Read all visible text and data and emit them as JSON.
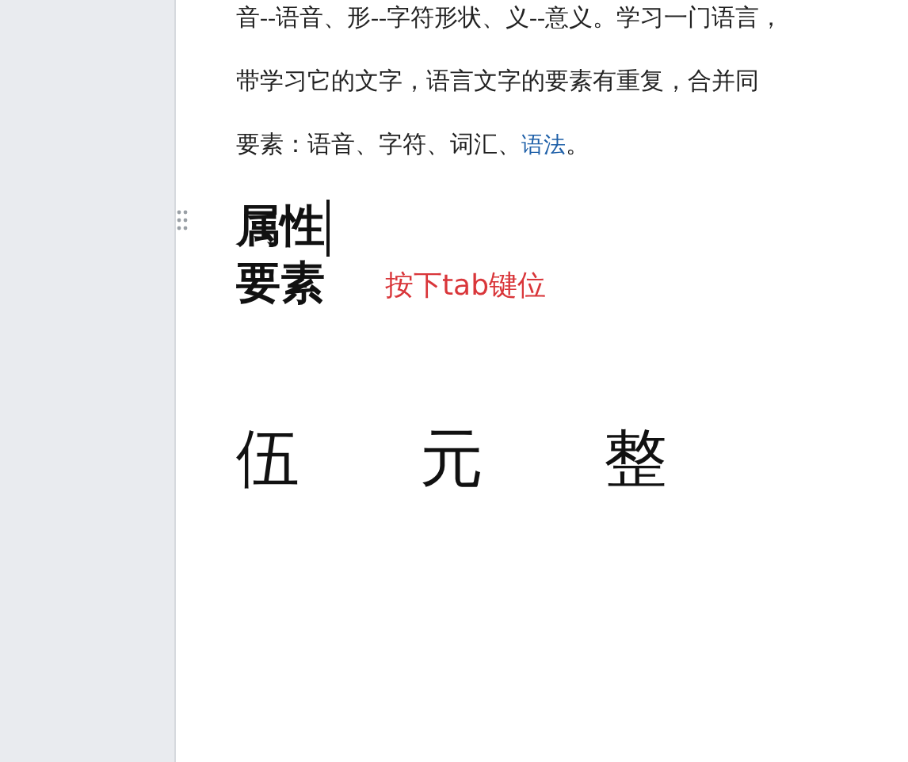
{
  "paragraphs": [
    [
      {
        "kind": "text",
        "text": "音--语音、形--字符形状、义--意义。学习一门语言，"
      }
    ],
    [
      {
        "kind": "text",
        "text": "带学习它的文字，语言文字的要素有重复，合并同"
      }
    ],
    [
      {
        "kind": "text",
        "text": "要素：语音、字符、词汇、"
      },
      {
        "kind": "link",
        "text": "语法"
      },
      {
        "kind": "text",
        "text": "。"
      }
    ]
  ],
  "headings": [
    {
      "text": "属性",
      "cursor": true
    },
    {
      "text": "要素",
      "cursor": false
    }
  ],
  "annotation": "按下tab键位",
  "amount": [
    "伍",
    "元",
    "整"
  ]
}
